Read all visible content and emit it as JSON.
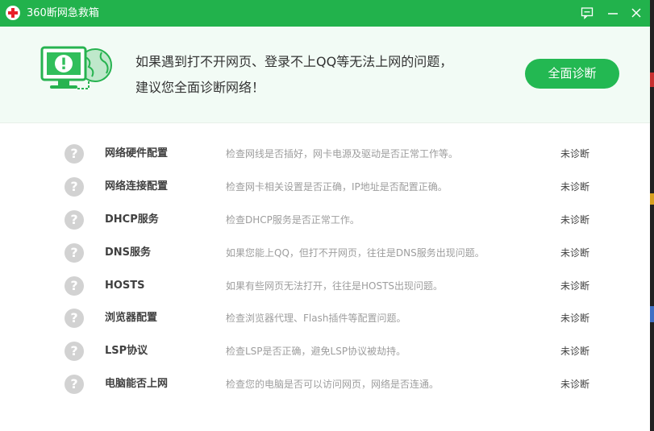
{
  "window": {
    "title": "360断网急救箱"
  },
  "titlebar": {
    "feedback_icon": "feedback-icon",
    "minimize_icon": "minimize-icon",
    "close_icon": "close-icon"
  },
  "banner": {
    "line1": "如果遇到打不开网页、登录不上QQ等无法上网的问题，",
    "line2": "建议您全面诊断网络！",
    "diagnose_button": "全面诊断",
    "illustration_icon": "computer-globe-warning-icon"
  },
  "items": [
    {
      "name": "网络硬件配置",
      "desc": "检查网线是否插好，网卡电源及驱动是否正常工作等。",
      "status": "未诊断"
    },
    {
      "name": "网络连接配置",
      "desc": "检查网卡相关设置是否正确，IP地址是否配置正确。",
      "status": "未诊断"
    },
    {
      "name": "DHCP服务",
      "desc": "检查DHCP服务是否正常工作。",
      "status": "未诊断"
    },
    {
      "name": "DNS服务",
      "desc": "如果您能上QQ，但打不开网页，往往是DNS服务出现问题。",
      "status": "未诊断"
    },
    {
      "name": "HOSTS",
      "desc": "如果有些网页无法打开，往往是HOSTS出现问题。",
      "status": "未诊断"
    },
    {
      "name": "浏览器配置",
      "desc": "检查浏览器代理、Flash插件等配置问题。",
      "status": "未诊断"
    },
    {
      "name": "LSP协议",
      "desc": "检查LSP是否正确，避免LSP协议被劫持。",
      "status": "未诊断"
    },
    {
      "name": "电脑能否上网",
      "desc": "检查您的电脑是否可以访问网页，网络是否连通。",
      "status": "未诊断"
    }
  ],
  "item_icon": {
    "name": "question-icon",
    "glyph": "?"
  },
  "colors": {
    "accent": "#22b24c",
    "button": "#23b852",
    "banner_bg": "#f2fbf5"
  }
}
